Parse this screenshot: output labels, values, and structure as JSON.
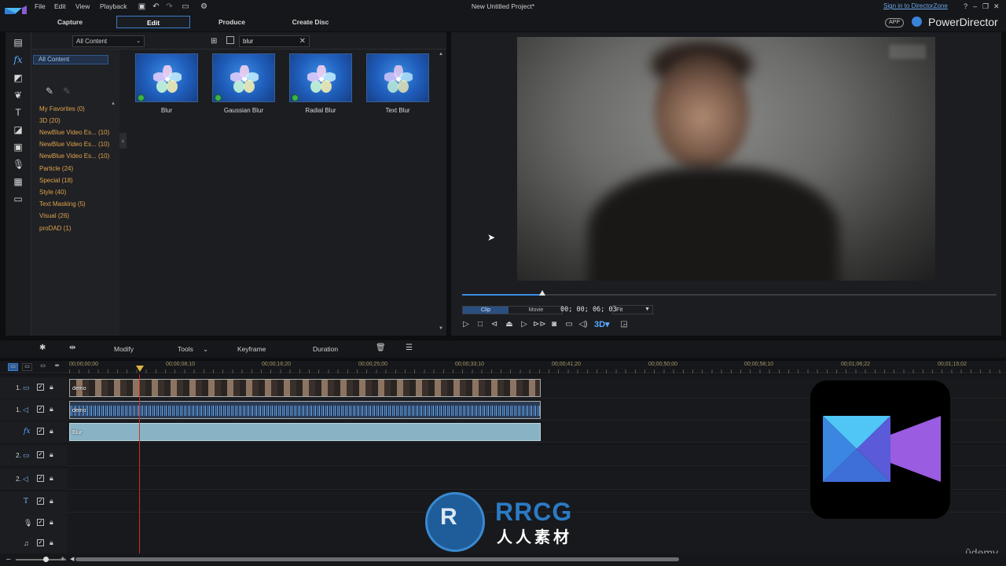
{
  "menu": {
    "items": [
      "File",
      "Edit",
      "View",
      "Playback"
    ],
    "project_title": "New Untitled Project*",
    "sign_in": "Sign in to DirectorZone",
    "help": "?"
  },
  "modes": {
    "tabs": [
      "Capture",
      "Edit",
      "Produce",
      "Create Disc"
    ],
    "active": "Edit",
    "app_badge": "APP",
    "brand": "PowerDirector"
  },
  "library": {
    "content_filter": "All Content",
    "search_value": "blur",
    "category_header": "All Content",
    "categories": [
      "My Favorites  (0)",
      "3D  (20)",
      "NewBlue Video Es...  (10)",
      "NewBlue Video Es...  (10)",
      "NewBlue Video Es...  (10)",
      "Particle  (24)",
      "Special  (18)",
      "Style  (40)",
      "Text Masking  (5)",
      "Visual  (26)",
      "proDAD  (1)"
    ],
    "effects": [
      "Blur",
      "Gaussian Blur",
      "Radial Blur",
      "Text Blur"
    ]
  },
  "preview": {
    "clip_label": "Clip",
    "movie_label": "Movie",
    "timecode": "00; 00; 06; 03",
    "fit": "Fit",
    "progress_fraction": 0.15
  },
  "timeline_toolbar": {
    "modify": "Modify",
    "tools": "Tools",
    "keyframe": "Keyframe",
    "duration": "Duration"
  },
  "ruler": {
    "labels": [
      "00;00;00;00",
      "00;00;08;10",
      "00;00;16;20",
      "00;00;25;00",
      "00;00;33;10",
      "00;00;41;20",
      "00;00;50;00",
      "00;00;58;10",
      "00;01;06;22",
      "00;01;15;02"
    ]
  },
  "tracks": [
    {
      "label": "1.",
      "type": "video",
      "clip": "demo"
    },
    {
      "label": "1.",
      "type": "audio",
      "clip": "demo"
    },
    {
      "label": "",
      "type": "fx",
      "clip": "Blur"
    },
    {
      "label": "2.",
      "type": "video",
      "clip": ""
    },
    {
      "label": "2.",
      "type": "audio",
      "clip": ""
    },
    {
      "label": "",
      "type": "title",
      "clip": ""
    },
    {
      "label": "",
      "type": "voice",
      "clip": ""
    },
    {
      "label": "",
      "type": "music",
      "clip": ""
    }
  ],
  "overlays": {
    "rrcg": "RRCG",
    "rrcg_sub": "人人素材",
    "udemy": "ûdemy"
  }
}
